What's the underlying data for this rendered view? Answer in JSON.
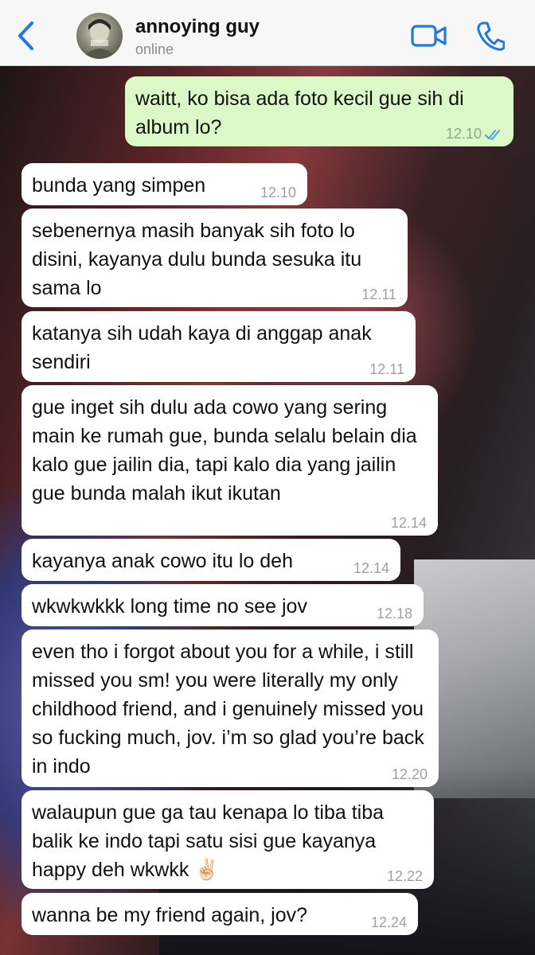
{
  "header": {
    "contact_name": "annoying guy",
    "status": "online",
    "icons": [
      "chevron-left-icon",
      "avatar",
      "video-camera-icon",
      "phone-icon"
    ],
    "accent_color": "#1f7ae0"
  },
  "messages": [
    {
      "direction": "outgoing",
      "text": "waitt, ko bisa ada foto kecil gue sih di album lo?",
      "time": "12.10",
      "read": true
    },
    {
      "direction": "incoming",
      "text": "bunda yang simpen",
      "time": "12.10"
    },
    {
      "direction": "incoming",
      "text": "sebenernya masih banyak sih foto lo disini, kayanya dulu bunda sesuka itu sama lo",
      "time": "12.11"
    },
    {
      "direction": "incoming",
      "text": "katanya sih udah kaya di anggap anak sendiri",
      "time": "12.11"
    },
    {
      "direction": "incoming",
      "text": "gue inget sih dulu ada cowo yang sering main ke rumah gue, bunda selalu belain dia kalo gue jailin dia, tapi kalo dia yang jailin gue bunda malah ikut ikutan",
      "time": "12.14"
    },
    {
      "direction": "incoming",
      "text": "kayanya anak cowo itu lo deh",
      "time": "12.14"
    },
    {
      "direction": "incoming",
      "text": "wkwkwkkk long time no see jov",
      "time": "12.18"
    },
    {
      "direction": "incoming",
      "text": "even tho i forgot about you for a while, i still missed you sm! you were literally my only childhood friend, and i genuinely missed you so fucking much, jov. i’m so glad you’re back in indo",
      "time": "12.20"
    },
    {
      "direction": "incoming",
      "text": "walaupun gue ga tau kenapa lo tiba tiba balik ke indo tapi satu sisi gue kayanya happy deh wkwkk ✌🏻",
      "time": "12.22"
    },
    {
      "direction": "incoming",
      "text": "wanna be my friend again, jov?",
      "time": "12.24"
    }
  ]
}
